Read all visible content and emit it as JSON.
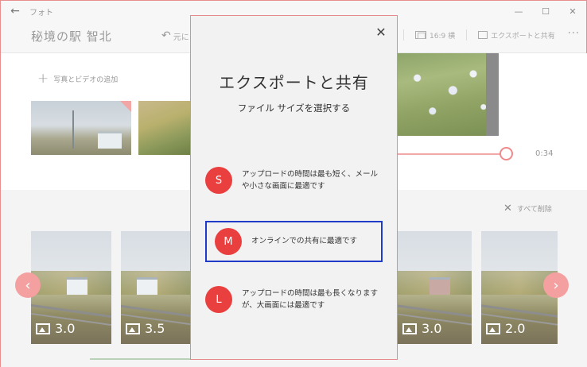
{
  "window": {
    "title": "フォト",
    "back_glyph": "←",
    "minimize_glyph": "—",
    "maximize_glyph": "☐",
    "close_glyph": "✕"
  },
  "header": {
    "project_title": "秘境の駅 智北",
    "undo_label": "元に",
    "aspect_ratio_label": "16:9 横",
    "export_share_label": "エクスポートと共有",
    "more_glyph": "···"
  },
  "library": {
    "add_media_label": "写真とビデオの追加"
  },
  "preview": {
    "duration": "0:34"
  },
  "storyboard": {
    "remove_all_label": "すべて削除",
    "cards": [
      {
        "duration": "3.0"
      },
      {
        "duration": "3.5"
      },
      {
        "duration": "3.0"
      },
      {
        "duration": "2.0"
      }
    ]
  },
  "modal": {
    "title": "エクスポートと共有",
    "subtitle": "ファイル サイズを選択する",
    "close_glyph": "✕",
    "options": [
      {
        "badge": "S",
        "description": "アップロードの時間は最も短く、メールや小さな画面に最適です"
      },
      {
        "badge": "M",
        "description": "オンラインでの共有に最適です"
      },
      {
        "badge": "L",
        "description": "アップロードの時間は最も長くなりますが、大画面には最適です"
      }
    ]
  },
  "colors": {
    "accent": "#ea3f3f",
    "focus_border": "#1f3bc8",
    "window_border": "#e98e8e"
  }
}
